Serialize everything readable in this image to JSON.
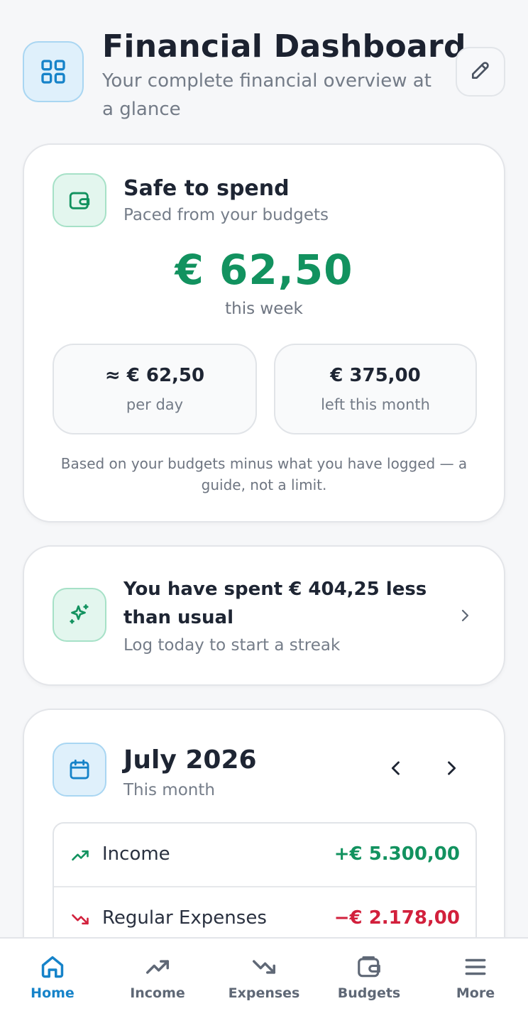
{
  "colors": {
    "accent_blue": "#1683c9",
    "positive_green": "#12925f",
    "negative_red": "#d2203c",
    "muted_text": "#757d89"
  },
  "header": {
    "title": "Financial Dashboard",
    "subtitle": "Your complete financial overview at a glance",
    "icon": "grid-icon",
    "edit_icon": "pencil-icon"
  },
  "safe_to_spend": {
    "icon": "wallet-icon",
    "title": "Safe to spend",
    "subtitle": "Paced from your budgets",
    "amount": "€ 62,50",
    "period": "this week",
    "stats": [
      {
        "value": "≈ € 62,50",
        "label": "per day"
      },
      {
        "value": "€ 375,00",
        "label": "left this month"
      }
    ],
    "note": "Based on your budgets minus what you have logged — a guide, not a limit."
  },
  "insight": {
    "icon": "sparkles-icon",
    "title": "You have spent € 404,25 less than usual",
    "subtitle": "Log today to start a streak",
    "chevron_icon": "chevron-right-icon"
  },
  "month_summary": {
    "icon": "calendar-icon",
    "title": "July 2026",
    "subtitle": "This month",
    "rows": [
      {
        "icon": "trending-up-icon",
        "label": "Income",
        "amount": "+€ 5.300,00"
      },
      {
        "icon": "trending-down-icon",
        "label": "Regular Expenses",
        "amount": "−€ 2.178,00"
      }
    ]
  },
  "bottom_nav": {
    "items": [
      {
        "label": "Home",
        "icon": "home-icon",
        "active": true
      },
      {
        "label": "Income",
        "icon": "trending-up-icon",
        "active": false
      },
      {
        "label": "Expenses",
        "icon": "trending-down-icon",
        "active": false
      },
      {
        "label": "Budgets",
        "icon": "wallet-icon",
        "active": false
      },
      {
        "label": "More",
        "icon": "menu-icon",
        "active": false
      }
    ]
  }
}
